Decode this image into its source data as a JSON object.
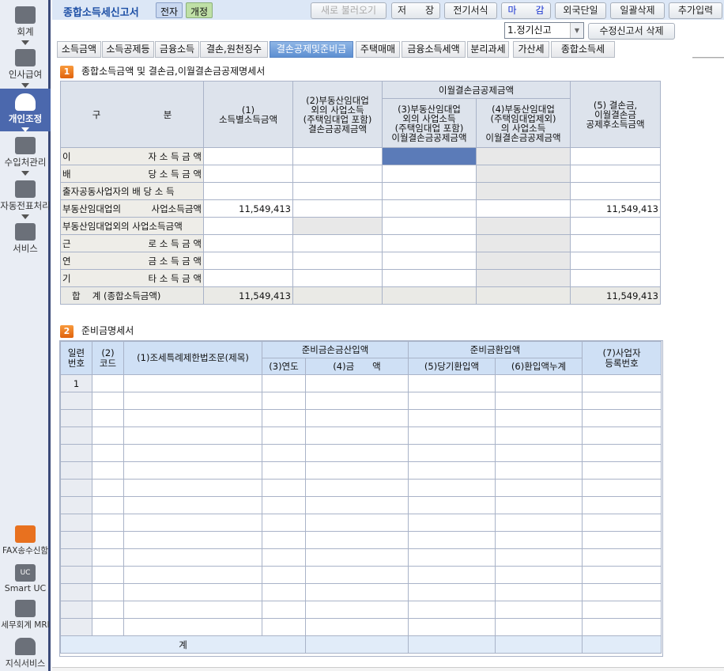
{
  "sidebar": {
    "items": [
      {
        "label": "회계"
      },
      {
        "label": "인사급여"
      },
      {
        "label": "개인조정"
      },
      {
        "label": "수입처관리"
      },
      {
        "label": "자동전표처리"
      },
      {
        "label": "서비스"
      }
    ],
    "bottom": [
      {
        "label": "FAX송수신함"
      },
      {
        "label": "Smart UC",
        "icon_text": "UC"
      },
      {
        "label": "세무회계 MRI"
      },
      {
        "label": "지식서비스"
      }
    ]
  },
  "header": {
    "title": "종합소득세신고서",
    "tag_e": "전자",
    "tag_rev": "개정",
    "buttons": [
      "새로 불러오기",
      "저　　장",
      "전기서식",
      "마　　감",
      "외국단일",
      "일괄삭제",
      "추가입력"
    ]
  },
  "filing": {
    "selected": "1.정기신고",
    "delete_amend": "수정신고서 삭제"
  },
  "tabs": [
    "소득금액",
    "소득공제등",
    "금융소득",
    "결손,원천징수",
    "결손공제및준비금",
    "주택매매",
    "금융소득세액",
    "분리과세",
    "가산세",
    "종합소득세"
  ],
  "section1": {
    "title": "종합소득금액 및 결손금,이월결손금공제명세서",
    "num": "1",
    "headers": {
      "c0a": "구",
      "c0b": "분",
      "c1": "(1)\n소득별소득금액",
      "c2": "(2)부동산임대업\n외의 사업소득\n(주택임대업 포함)\n결손금공제금액",
      "group": "이월결손금공제금액",
      "c3": "(3)부동산임대업\n외의 사업소득\n(주택임대업 포함)\n이월결손금공제금액",
      "c4": "(4)부동산임대업\n(주택임대업제외)\n의 사업소득\n이월결손금공제금액",
      "c5": "(5) 결손금,\n이월결손금\n공제후소득금액"
    },
    "rows": [
      {
        "a": "이",
        "b": "자 소 득 금 액",
        "v1": "",
        "v5": ""
      },
      {
        "a": "배",
        "b": "당 소 득 금 액",
        "v1": "",
        "v5": ""
      },
      {
        "a": "출자공동사업자의 배 당 소 득",
        "b": "",
        "v1": "",
        "v5": ""
      },
      {
        "a": "부동산임대업의",
        "b": "사업소득금액",
        "v1": "11,549,413",
        "v5": "11,549,413"
      },
      {
        "a": "부동산임대업외의 사업소득금액",
        "b": "",
        "v1": "",
        "v5": ""
      },
      {
        "a": "근",
        "b": "로 소 득 금 액",
        "v1": "",
        "v5": ""
      },
      {
        "a": "연",
        "b": "금 소 득 금 액",
        "v1": "",
        "v5": ""
      },
      {
        "a": "기",
        "b": "타 소 득 금 액",
        "v1": "",
        "v5": ""
      }
    ],
    "total": {
      "label": "합　 계 (종합소득금액)",
      "v1": "11,549,413",
      "v5": "11,549,413"
    }
  },
  "section2": {
    "title": "준비금명세서",
    "num": "2",
    "headers": {
      "serial": "일련\n번호",
      "code": "(2)\n코드",
      "article": "(1)조세특례제한법조문(제목)",
      "g1": "준비금손금산입액",
      "year": "(3)연도",
      "amount": "(4)금　　액",
      "g2": "준비금환입액",
      "cur": "(5)당기환입액",
      "cum": "(6)환입액누계",
      "biz": "(7)사업자\n등록번호"
    },
    "rows": [
      "1",
      "",
      "",
      "",
      "",
      "",
      "",
      "",
      "",
      "",
      "",
      "",
      "",
      "",
      ""
    ],
    "total_label": "계"
  }
}
